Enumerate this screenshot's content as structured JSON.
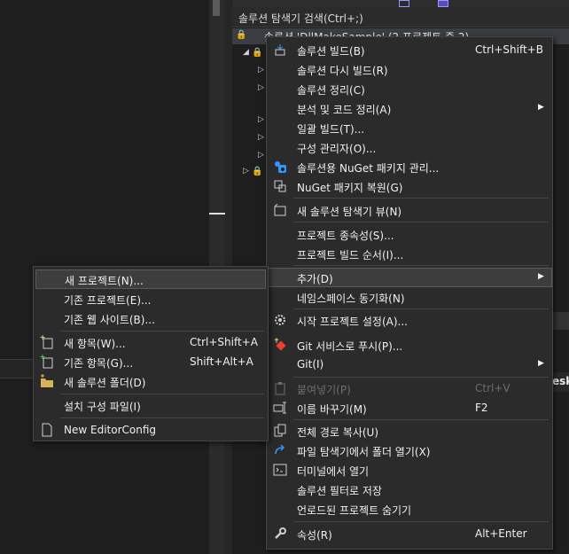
{
  "solution_explorer": {
    "search_label": "솔루션 탐색기 검색(Ctrl+;)",
    "solution_row": "솔루션 'DllMakeSample' (2 프로젝트 중 2)",
    "partial_text": "esk"
  },
  "main_menu": {
    "items": [
      {
        "label": "솔루션 빌드(B)",
        "shortcut": "Ctrl+Shift+B",
        "icon": "build-solution-icon"
      },
      {
        "label": "솔루션 다시 빌드(R)"
      },
      {
        "label": "솔루션 정리(C)"
      },
      {
        "label": "분석 및 코드 정리(A)",
        "submenu": true
      },
      {
        "label": "일괄 빌드(T)..."
      },
      {
        "label": "구성 관리자(O)..."
      },
      {
        "label": "솔루션용 NuGet 패키지 관리...",
        "icon": "nuget-icon"
      },
      {
        "label": "NuGet 패키지 복원(G)",
        "icon": "nuget-restore-icon"
      },
      {
        "label": "새 솔루션 탐색기 뷰(N)",
        "icon": "new-view-icon"
      },
      {
        "label": "프로젝트 종속성(S)..."
      },
      {
        "label": "프로젝트 빌드 순서(I)..."
      },
      {
        "label": "추가(D)",
        "submenu": true,
        "highlighted": true
      },
      {
        "label": "네임스페이스 동기화(N)"
      },
      {
        "label": "시작 프로젝트 설정(A)...",
        "icon": "gear-icon"
      },
      {
        "label": "Git 서비스로 푸시(P)...",
        "icon": "git-push-icon"
      },
      {
        "label": "Git(I)",
        "submenu": true
      },
      {
        "label": "붙여넣기(P)",
        "shortcut": "Ctrl+V",
        "disabled": true,
        "icon": "paste-icon"
      },
      {
        "label": "이름 바꾸기(M)",
        "shortcut": "F2",
        "icon": "rename-icon"
      },
      {
        "label": "전체 경로 복사(U)",
        "icon": "copy-icon"
      },
      {
        "label": "파일 탐색기에서 폴더 열기(X)",
        "icon": "open-folder-icon"
      },
      {
        "label": "터미널에서 열기",
        "icon": "terminal-icon"
      },
      {
        "label": "솔루션 필터로 저장"
      },
      {
        "label": "언로드된 프로젝트 숨기기"
      },
      {
        "label": "속성(R)",
        "shortcut": "Alt+Enter",
        "icon": "wrench-icon"
      }
    ]
  },
  "add_submenu": {
    "items": [
      {
        "label": "새 프로젝트(N)...",
        "highlighted": true
      },
      {
        "label": "기존 프로젝트(E)..."
      },
      {
        "label": "기존 웹 사이트(B)..."
      },
      {
        "label": "새 항목(W)...",
        "shortcut": "Ctrl+Shift+A",
        "icon": "new-item-icon"
      },
      {
        "label": "기존 항목(G)...",
        "shortcut": "Shift+Alt+A",
        "icon": "existing-item-icon"
      },
      {
        "label": "새 솔루션 폴더(D)",
        "icon": "solution-folder-icon"
      },
      {
        "label": "설치 구성 파일(I)"
      },
      {
        "label": "New EditorConfig",
        "icon": "file-icon"
      }
    ]
  },
  "colors": {
    "menu_bg": "#2b2b2b",
    "highlight": "#3d3d3d",
    "accent_blue": "#3794ff",
    "git_red": "#e8412c"
  }
}
